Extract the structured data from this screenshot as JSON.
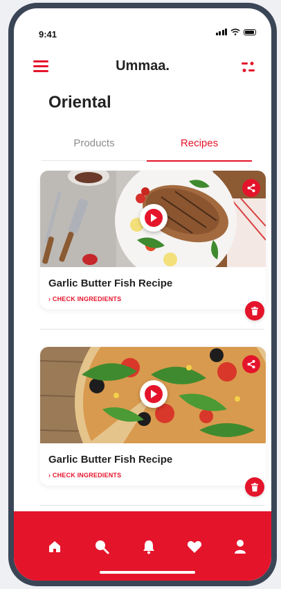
{
  "status": {
    "time": "9:41"
  },
  "header": {
    "title": "Ummaa."
  },
  "page": {
    "title": "Oriental"
  },
  "tabs": [
    {
      "label": "Products",
      "active": false
    },
    {
      "label": "Recipes",
      "active": true
    }
  ],
  "recipes": [
    {
      "title": "Garlic Butter Fish Recipe",
      "link_label": "CHECK INGREDIENTS",
      "image": "grilled-fish-plate"
    },
    {
      "title": "Garlic Butter Fish Recipe",
      "link_label": "CHECK INGREDIENTS",
      "image": "pizza-arugula"
    }
  ],
  "bottom_nav": [
    "home-icon",
    "search-icon",
    "bell-icon",
    "heart-icon",
    "user-icon"
  ],
  "colors": {
    "accent": "#e4142b",
    "frame": "#3a4556",
    "text": "#222222",
    "muted": "#8c8c8c"
  }
}
